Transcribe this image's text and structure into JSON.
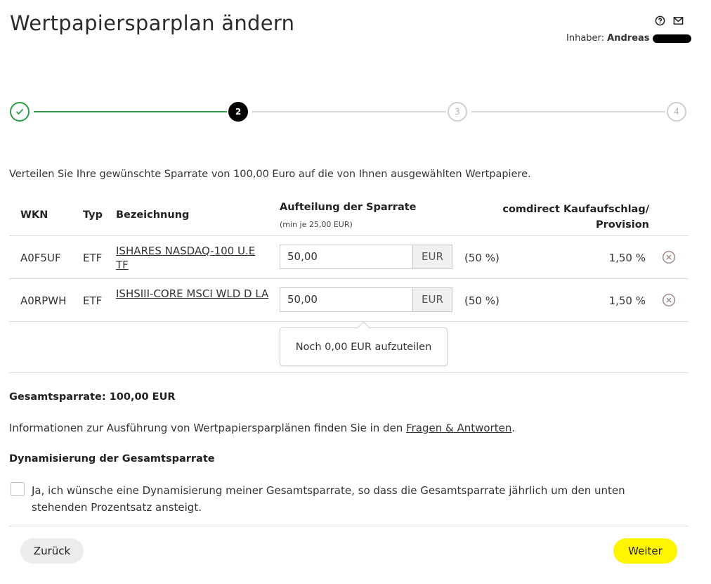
{
  "header": {
    "title": "Wertpapiersparplan ändern",
    "owner_label": "Inhaber:",
    "owner_name": "Andreas",
    "icons": [
      "help-icon",
      "mail-icon"
    ]
  },
  "stepper": {
    "steps": [
      "",
      "2",
      "3",
      "4"
    ],
    "current_step": 2,
    "completed_color": "#2e9e4a",
    "active_color": "#000000"
  },
  "intro_text": "Verteilen Sie Ihre gewünschte Sparrate von 100,00 Euro auf die von Ihnen ausgewählten Wertpapiere.",
  "table": {
    "headers": {
      "wkn": "WKN",
      "typ": "Typ",
      "bezeichnung": "Bezeichnung",
      "aufteilung": "Aufteilung der Sparrate",
      "aufteilung_hint": "(min je 25,00 EUR)",
      "kauf_line1": "comdirect Kaufaufschlag/",
      "kauf_line2": "Provision"
    },
    "rows": [
      {
        "wkn": "A0F5UF",
        "typ": "ETF",
        "name": "ISHARES NASDAQ-100 U.E TF",
        "amount": "50,00",
        "currency": "EUR",
        "percent": "(50 %)",
        "fee": "1,50 %"
      },
      {
        "wkn": "A0RPWH",
        "typ": "ETF",
        "name": "ISHSIII-CORE MSCI WLD D LA",
        "amount": "50,00",
        "currency": "EUR",
        "percent": "(50 %)",
        "fee": "1,50 %"
      }
    ],
    "remaining_tooltip": "Noch 0,00 EUR aufzuteilen"
  },
  "total": "Gesamtsparrate: 100,00 EUR",
  "info": {
    "text_before": "Informationen zur Ausführung von Wertpapiersparplänen finden Sie in den ",
    "link": "Fragen & Antworten",
    "text_after": "."
  },
  "dynamization": {
    "heading": "Dynamisierung der Gesamtsparrate",
    "checkbox_label": "Ja, ich wünsche eine Dynamisierung meiner Gesamtsparrate, so dass die Gesamtsparrate jährlich um den unten stehenden Prozentsatz ansteigt.",
    "checked": false
  },
  "buttons": {
    "back": "Zurück",
    "next": "Weiter"
  },
  "colors": {
    "accent_yellow": "#fff500",
    "success_green": "#2e9e4a"
  }
}
